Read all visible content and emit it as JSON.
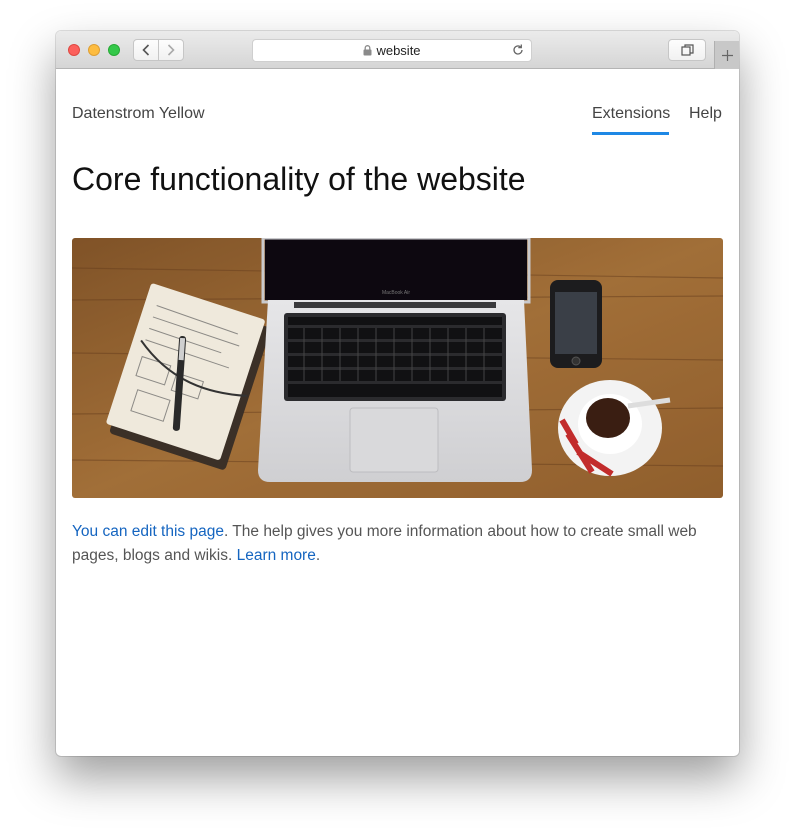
{
  "browser": {
    "url": "website",
    "icons": [
      "back-arrow-icon",
      "forward-arrow-icon",
      "lock-icon",
      "reload-icon",
      "tabs-overview-icon",
      "plus-icon"
    ]
  },
  "site": {
    "name": "Datenstrom Yellow",
    "nav": [
      {
        "label": "Extensions",
        "active": true
      },
      {
        "label": "Help",
        "active": false
      }
    ],
    "accent_color": "#1e88e5",
    "link_color": "#1565c0"
  },
  "page": {
    "title": "Core functionality of the website",
    "hero_image": "laptop-notebook-phone-coffee-on-wooden-desk",
    "laptop_label": "MacBook Air",
    "paragraph": {
      "link_edit": "You can edit this page",
      "text": ". The help gives you more information about how to create small web pages, blogs and wikis. ",
      "link_learn": "Learn more",
      "end": "."
    }
  }
}
